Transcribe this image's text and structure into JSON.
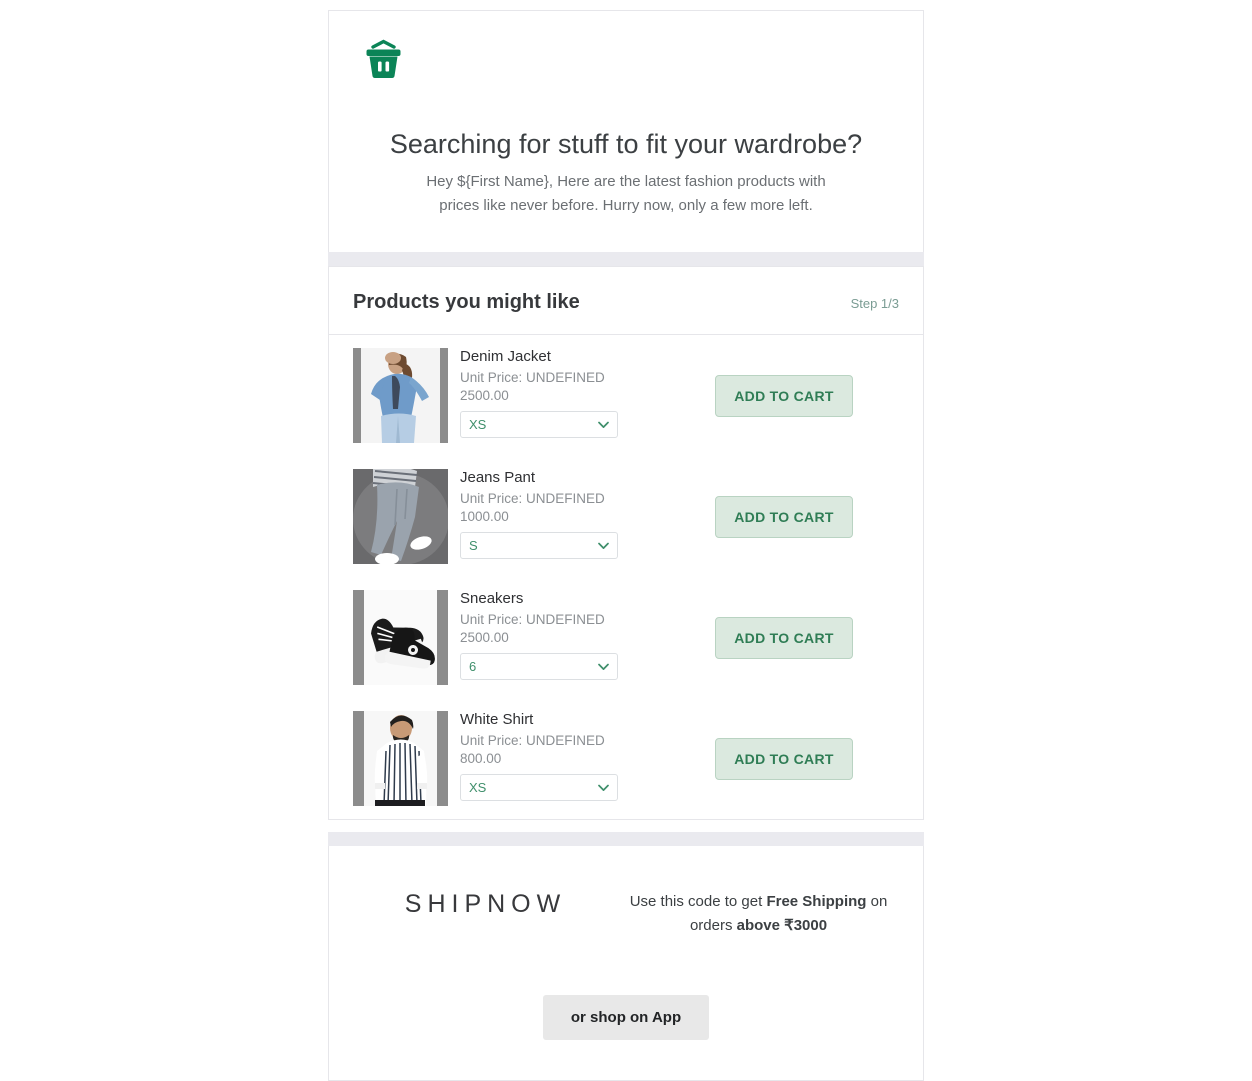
{
  "brand": {
    "icon": "shopping-basket-icon",
    "icon_color": "#0b8457"
  },
  "hero": {
    "title": "Searching for stuff to fit your wardrobe?",
    "subtitle": "Hey ${First Name}, Here are the latest fashion products with prices like never before. Hurry now, only a few more left."
  },
  "products_section": {
    "title": "Products you might like",
    "step": "Step 1/3",
    "step_color": "#7a9c93",
    "items": [
      {
        "name": "Denim Jacket",
        "price_line_1": "Unit Price: UNDEFINED",
        "price_line_2": "2500.00",
        "size": "XS",
        "image": "denim-jacket-photo",
        "cta": "ADD TO CART"
      },
      {
        "name": "Jeans Pant",
        "price_line_1": "Unit Price: UNDEFINED",
        "price_line_2": "1000.00",
        "size": "S",
        "image": "jeans-pant-photo",
        "cta": "ADD TO CART"
      },
      {
        "name": "Sneakers",
        "price_line_1": "Unit Price: UNDEFINED",
        "price_line_2": "2500.00",
        "size": "6",
        "image": "sneakers-photo",
        "cta": "ADD TO CART"
      },
      {
        "name": "White Shirt",
        "price_line_1": "Unit Price: UNDEFINED",
        "price_line_2": "800.00",
        "size": "XS",
        "image": "white-shirt-photo",
        "cta": "ADD TO CART"
      }
    ]
  },
  "footer": {
    "promo_code": "SHIPNOW",
    "promo_text_1": "Use this code to get ",
    "promo_text_bold_1": "Free Shipping",
    "promo_text_2": " on orders ",
    "promo_text_bold_2": "above ₹3000",
    "app_button": "or shop on App"
  },
  "colors": {
    "accent_green": "#2f7d55",
    "button_bg": "#dbe9df",
    "band": "#eaeaef"
  }
}
